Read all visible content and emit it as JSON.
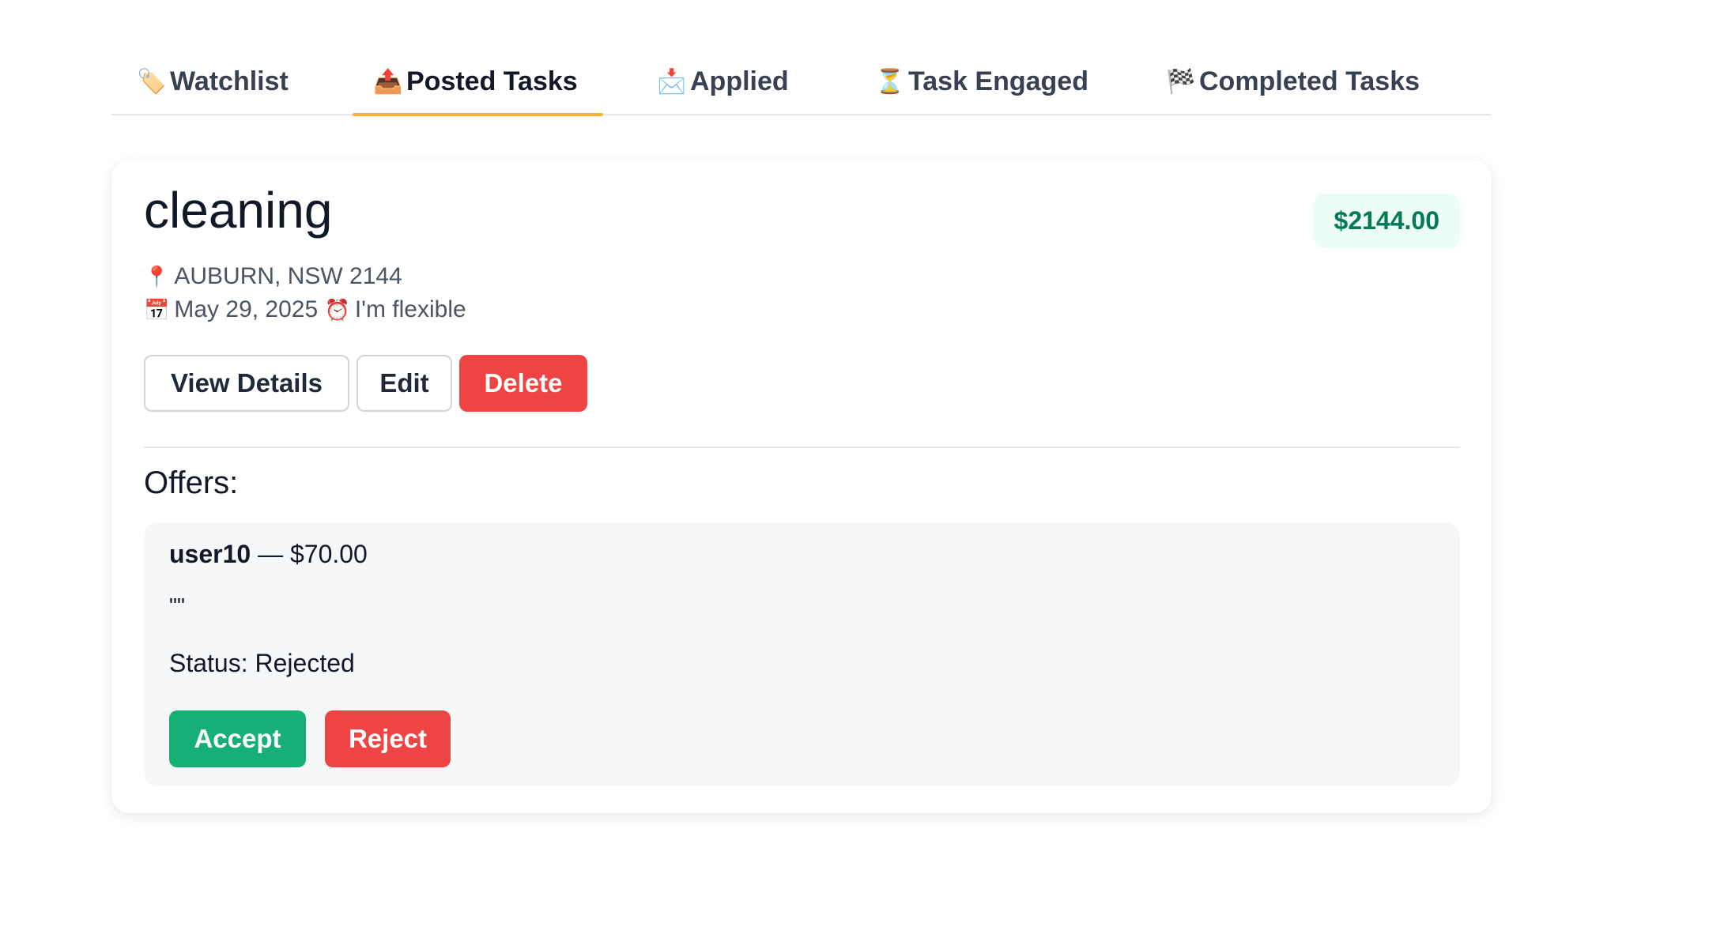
{
  "tabs": [
    {
      "icon": "🏷️",
      "icon_name": "tag-icon",
      "label": "Watchlist"
    },
    {
      "icon": "📤",
      "icon_name": "outbox-tray-icon",
      "label": "Posted Tasks",
      "active": true
    },
    {
      "icon": "📩",
      "icon_name": "envelope-arrow-icon",
      "label": "Applied"
    },
    {
      "icon": "⏳",
      "icon_name": "hourglass-icon",
      "label": "Task Engaged"
    },
    {
      "icon": "🏁",
      "icon_name": "checkered-flag-icon",
      "label": "Completed Tasks"
    }
  ],
  "task": {
    "title": "cleaning",
    "price": "$2144.00",
    "location_icon": "📍",
    "location": "AUBURN, NSW 2144",
    "date_icon": "📅",
    "date": "May 29, 2025",
    "time_icon": "⏰",
    "time": "I'm flexible",
    "buttons": {
      "view_details": "View Details",
      "edit": "Edit",
      "delete": "Delete"
    }
  },
  "offers": {
    "title": "Offers:",
    "items": [
      {
        "user": "user10",
        "separator": " — ",
        "amount": "$70.00",
        "message": "\"\"",
        "status": "Status: Rejected",
        "accept_label": "Accept",
        "reject_label": "Reject"
      }
    ]
  },
  "colors": {
    "accent_underline": "#f5b335",
    "price_bg": "#ecfdf5",
    "price_text": "#047857",
    "danger": "#ef4444",
    "success": "#16b076"
  }
}
